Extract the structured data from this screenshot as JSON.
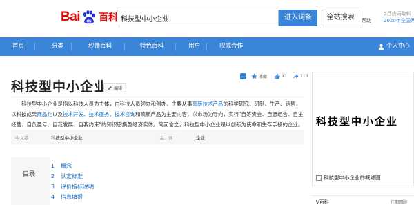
{
  "header": {
    "logo_bai": "Bai",
    "logo_du": "du",
    "logo_baike": "百科",
    "search_value": "科技型中小企业",
    "enter_button": "进入词条",
    "global_search_button": "全站搜索",
    "help": "帮助",
    "promo_line1": "5月热词取料",
    "promo_line2": "2020年全国两"
  },
  "nav": {
    "items": [
      "首页",
      "分类",
      "秒懂百科",
      "特色百科",
      "用户",
      "权威合作"
    ],
    "user_center": "个人中心"
  },
  "entry": {
    "title": "科技型中小企业",
    "edit_label": "编辑",
    "collect_label": "收藏",
    "like_count": "93",
    "share_count": "113",
    "summary_parts": [
      "科技型中小企业是指以科技人员为主体，由科技人员领办和创办，主要从事",
      "高新技术产品",
      "的科学研究、研制、生产、销售，以科技成果",
      "商品化",
      "以及",
      "技术开发",
      "、",
      "技术服务",
      "、",
      "技术咨询",
      "和高新产品为主要内容，以市场为导向，实行\"自筹资金、自愿组合、自主经营、自负盈亏、自我发展、自我约束\"的知识密集型经济实体。简而言之，科技型中小企业是以创新为使命和生存手段的企业。"
    ],
    "basic_info": {
      "k1": "中文名",
      "v1": "科技型中小企业",
      "k2": "主　体",
      "v2": "企业"
    },
    "toc": {
      "label": "目录",
      "items": [
        {
          "num": "1",
          "label": "概念"
        },
        {
          "num": "2",
          "label": "认定标准"
        },
        {
          "num": "3",
          "label": "评价指标说明"
        },
        {
          "num": "4",
          "label": "信息填报"
        }
      ]
    }
  },
  "side": {
    "image_text": "科技型中小企业",
    "caption": "科技型中小企业的概述图",
    "vbaike_title": "V百科",
    "vbaike_more": "往期回顾"
  },
  "colors": {
    "brand_red": "#e10601",
    "brand_blue": "#3a85d8",
    "link_blue": "#136ec2"
  }
}
